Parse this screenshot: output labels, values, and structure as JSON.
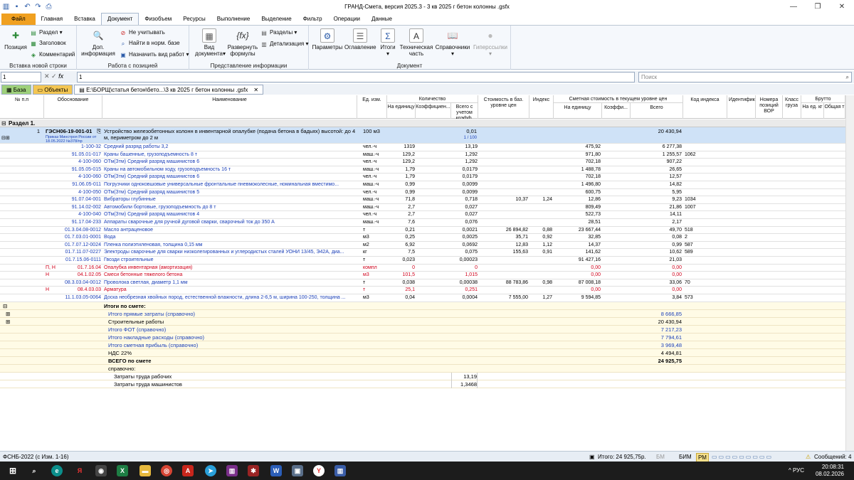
{
  "window": {
    "title": "ГРАНД-Смета, версия 2025.3 - 3 кв 2025 г  бетон колонны .gsfx"
  },
  "menu": {
    "tabs": [
      "Файл",
      "Главная",
      "Вставка",
      "Документ",
      "Физобъем",
      "Ресурсы",
      "Выполнение",
      "Выделение",
      "Фильтр",
      "Операции",
      "Данные"
    ]
  },
  "ribbon": {
    "g1": {
      "label": "Вставка новой строки",
      "position": "Позиция",
      "section": "Раздел",
      "heading": "Заголовок",
      "comment": "Комментарий"
    },
    "g2": {
      "label": "Работа с позицией",
      "add_info1": "Доп.",
      "add_info2": "информация",
      "ignore": "Не учитывать",
      "find_norm": "Найти в норм. базе",
      "assign_type": "Назначить вид работ"
    },
    "g3": {
      "label": "Представление информации",
      "doc_view1": "Вид",
      "doc_view2": "документа",
      "expand1": "Развернуть",
      "expand2": "формулы",
      "sections": "Разделы",
      "detail": "Детализация"
    },
    "g4": {
      "label": "Документ",
      "params": "Параметры",
      "toc": "Оглавление",
      "totals": "Итоги",
      "tech1": "Техническая",
      "tech2": "часть",
      "refs": "Справочники",
      "hyper": "Гиперссылки"
    }
  },
  "formula_bar": {
    "cell": "1",
    "value": "1",
    "search_placeholder": "Поиск"
  },
  "doc_tabs": {
    "base": "База",
    "objects": "Объекты",
    "file": "E:\\БОРЩ\\статья бетон\\бето...\\3 кв 2025 г  бетон колонны .gsfx"
  },
  "headers": {
    "num": "№ п.п",
    "basis": "Обоснование",
    "name": "Наименование",
    "unit": "Ед. изм.",
    "qty": "Количество",
    "qty_per": "На единицу",
    "qty_coef": "Коэффициен...",
    "qty_total": "Всего с учетом коэфф.",
    "base_cost": "Стоимость в баз. уровне цен",
    "index": "Индекс",
    "cur_cost": "Сметная стоимость в текущем уровне цен",
    "cur_per": "На единицу",
    "cur_coef": "Коэффи...",
    "cur_total": "Всего",
    "idx_code": "Код индекса",
    "ident": "Идентификатор",
    "vor": "Номера позиций ВОР",
    "cargo": "Класс груза",
    "gross": "Брутто",
    "gross_unit": "На ед. кг",
    "gross_total": "Общая т"
  },
  "section_title": "Раздел 1.",
  "position": {
    "num": "1",
    "code": "ГЭСН06-19-001-01",
    "order": "Приказ Минстроя России от 18.05.2022 №378/пр",
    "name1": "Устройство железобетонных колонн в инвентарной опалубке (подача бетона в бадьях) высотой: до 4",
    "name2": "м, периметром до 2 м",
    "unit": "100 м3",
    "qty": "0,01",
    "qty2": "1 / 100",
    "total": "20 430,94"
  },
  "resources": [
    {
      "flag": "",
      "code": "1-100-32",
      "name": "Средний разряд работы 3,2",
      "unit": "чел.-ч",
      "per": "1319",
      "total": "13,19",
      "base": "",
      "idx": "",
      "cur": "475,92",
      "sum": "6 277,38",
      "icode": "",
      "red": false
    },
    {
      "flag": "",
      "code": "91.05.01-017",
      "name": "Краны башенные, грузоподъемность 8 т",
      "unit": "маш.-ч",
      "per": "129,2",
      "total": "1,292",
      "base": "",
      "idx": "",
      "cur": "971,80",
      "sum": "1 255,57",
      "icode": "1062",
      "red": false
    },
    {
      "flag": "",
      "code": "4-100-060",
      "name": "ОТм(Зтм) Средний разряд машинистов 6",
      "unit": "чел.-ч",
      "per": "129,2",
      "total": "1,292",
      "base": "",
      "idx": "",
      "cur": "702,18",
      "sum": "907,22",
      "icode": "",
      "red": false
    },
    {
      "flag": "",
      "code": "91.05.05-015",
      "name": "Краны на автомобильном ходу, грузоподъемность 16 т",
      "unit": "маш.-ч",
      "per": "1,79",
      "total": "0,0179",
      "base": "",
      "idx": "",
      "cur": "1 488,78",
      "sum": "26,65",
      "icode": "",
      "red": false
    },
    {
      "flag": "",
      "code": "4-100-060",
      "name": "ОТм(Зтм) Средний разряд машинистов 6",
      "unit": "чел.-ч",
      "per": "1,79",
      "total": "0,0179",
      "base": "",
      "idx": "",
      "cur": "702,18",
      "sum": "12,57",
      "icode": "",
      "red": false
    },
    {
      "flag": "",
      "code": "91.06.05-011",
      "name": "Погрузчики одноковшовые универсальные фронтальные пневмоколесные, номинальная вместимо...",
      "unit": "маш.-ч",
      "per": "0,99",
      "total": "0,0099",
      "base": "",
      "idx": "",
      "cur": "1 496,80",
      "sum": "14,82",
      "icode": "",
      "red": false
    },
    {
      "flag": "",
      "code": "4-100-050",
      "name": "ОТм(Зтм) Средний разряд машинистов 5",
      "unit": "чел.-ч",
      "per": "0,99",
      "total": "0,0099",
      "base": "",
      "idx": "",
      "cur": "600,75",
      "sum": "5,95",
      "icode": "",
      "red": false
    },
    {
      "flag": "",
      "code": "91.07.04-001",
      "name": "Вибраторы глубинные",
      "unit": "маш.-ч",
      "per": "71,8",
      "total": "0,718",
      "base": "10,37",
      "idx": "1,24",
      "cur": "12,86",
      "sum": "9,23",
      "icode": "1034",
      "red": false
    },
    {
      "flag": "",
      "code": "91.14.02-002",
      "name": "Автомобили бортовые, грузоподъемность до 8 т",
      "unit": "маш.-ч",
      "per": "2,7",
      "total": "0,027",
      "base": "",
      "idx": "",
      "cur": "809,49",
      "sum": "21,86",
      "icode": "1007",
      "red": false
    },
    {
      "flag": "",
      "code": "4-100-040",
      "name": "ОТм(Зтм) Средний разряд машинистов 4",
      "unit": "чел.-ч",
      "per": "2,7",
      "total": "0,027",
      "base": "",
      "idx": "",
      "cur": "522,73",
      "sum": "14,11",
      "icode": "",
      "red": false
    },
    {
      "flag": "",
      "code": "91.17.04-233",
      "name": "Аппараты сварочные для ручной дуговой сварки, сварочный ток до 350 А",
      "unit": "маш.-ч",
      "per": "7,6",
      "total": "0,076",
      "base": "",
      "idx": "",
      "cur": "28,51",
      "sum": "2,17",
      "icode": "",
      "red": false
    },
    {
      "flag": "",
      "code": "01.3.04.08-0012",
      "name": "Масло антраценовое",
      "unit": "т",
      "per": "0,21",
      "total": "0,0021",
      "base": "26 894,82",
      "idx": "0,88",
      "cur": "23 667,44",
      "sum": "49,70",
      "icode": "518",
      "red": false
    },
    {
      "flag": "",
      "code": "01.7.03.01-0001",
      "name": "Вода",
      "unit": "м3",
      "per": "0,25",
      "total": "0,0025",
      "base": "35,71",
      "idx": "0,92",
      "cur": "32,85",
      "sum": "0,08",
      "icode": "2",
      "red": false
    },
    {
      "flag": "",
      "code": "01.7.07.12-0024",
      "name": "Пленка полиэтиленовая, толщина 0,15 мм",
      "unit": "м2",
      "per": "6,92",
      "total": "0,0692",
      "base": "12,83",
      "idx": "1,12",
      "cur": "14,37",
      "sum": "0,99",
      "icode": "587",
      "red": false
    },
    {
      "flag": "",
      "code": "01.7.11.07-0227",
      "name": "Электроды сварочные для сварки низколегированных и углеродистых сталей УОНИ 13/45, Э42А, диа...",
      "unit": "кг",
      "per": "7,5",
      "total": "0,075",
      "base": "155,63",
      "idx": "0,91",
      "cur": "141,62",
      "sum": "10,62",
      "icode": "589",
      "red": false
    },
    {
      "flag": "",
      "code": "01.7.15.06-0111",
      "name": "Гвозди строительные",
      "unit": "т",
      "per": "0,023",
      "total": "0,00023",
      "base": "",
      "idx": "",
      "cur": "91 427,16",
      "sum": "21,03",
      "icode": "",
      "red": false
    },
    {
      "flag": "П, Н",
      "code": "01.7.16.04",
      "name": "Опалубка инвентарная (амортизация)",
      "unit": "компл",
      "per": "0",
      "total": "0",
      "base": "",
      "idx": "",
      "cur": "0,00",
      "sum": "0,00",
      "icode": "",
      "red": true
    },
    {
      "flag": "Н",
      "code": "04.1.02.05",
      "name": "Смеси бетонные тяжелого бетона",
      "unit": "м3",
      "per": "101,5",
      "total": "1,015",
      "base": "",
      "idx": "",
      "cur": "0,00",
      "sum": "0,00",
      "icode": "",
      "red": true
    },
    {
      "flag": "",
      "code": "08.3.03.04-0012",
      "name": "Проволока светлая, диаметр 1,1 мм",
      "unit": "т",
      "per": "0,038",
      "total": "0,00038",
      "base": "88 783,86",
      "idx": "0,98",
      "cur": "87 008,18",
      "sum": "33,06",
      "icode": "70",
      "red": false
    },
    {
      "flag": "Н",
      "code": "08.4.03.03",
      "name": "Арматура",
      "unit": "т",
      "per": "25,1",
      "total": "0,251",
      "base": "",
      "idx": "",
      "cur": "0,00",
      "sum": "0,00",
      "icode": "",
      "red": true
    },
    {
      "flag": "",
      "code": "11.1.03.05-0064",
      "name": "Доска необрезная хвойных пород, естественной влажности, длина 2-6,5 м, ширина 100-250, толщина ...",
      "unit": "м3",
      "per": "0,04",
      "total": "0,0004",
      "base": "7 555,00",
      "idx": "1,27",
      "cur": "9 594,85",
      "sum": "3,84",
      "icode": "573",
      "red": false
    }
  ],
  "totals": {
    "title": "Итоги по смете:",
    "items": [
      {
        "label": "Итого прямые затраты (справочно)",
        "value": "8 666,85",
        "style": "blue"
      },
      {
        "label": "Строительные работы",
        "value": "20 430,94",
        "style": "plain"
      },
      {
        "label": "Итого ФОТ (справочно)",
        "value": "7 217,23",
        "style": "blue"
      },
      {
        "label": "Итого накладные расходы (справочно)",
        "value": "7 794,61",
        "style": "blue"
      },
      {
        "label": "Итого сметная прибыль (справочно)",
        "value": "3 969,48",
        "style": "blue"
      },
      {
        "label": "НДС 22%",
        "value": "4 494,81",
        "style": "plain"
      },
      {
        "label": "ВСЕГО по смете",
        "value": "24 925,75",
        "style": "bold"
      },
      {
        "label": "справочно:",
        "value": "",
        "style": "plain"
      }
    ],
    "labor_workers": "Затраты труда рабочих",
    "labor_workers_val": "13,19",
    "labor_machinists": "Затраты труда машинистов",
    "labor_machinists_val": "1,3468"
  },
  "status": {
    "left": "ФСНБ-2022 (с Изм. 1-16)",
    "total": "Итого: 24 925,75р.",
    "bm": "БМ",
    "bim": "БИМ",
    "rm": "РМ",
    "messages": "Сообщений: 4"
  },
  "taskbar": {
    "lang": "РУС",
    "time": "20:08:31",
    "date": "08.02.2026"
  }
}
